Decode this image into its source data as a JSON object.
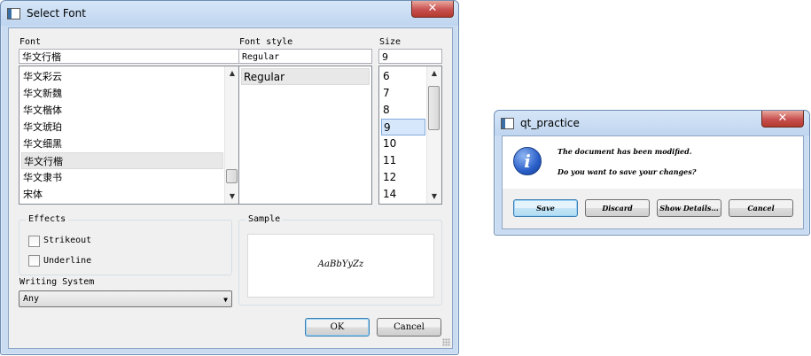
{
  "font_dialog": {
    "title": "Select Font",
    "close_symbol": "✕",
    "font": {
      "label": "Font",
      "value": "华文行楷",
      "items": [
        "华文彩云",
        "华文新魏",
        "华文楷体",
        "华文琥珀",
        "华文细黑",
        "华文行楷",
        "华文隶书",
        "宋体"
      ],
      "selected": "华文行楷"
    },
    "font_style": {
      "label": "Font style",
      "value": "Regular",
      "items": [
        "Regular"
      ],
      "selected": "Regular"
    },
    "size": {
      "label": "Size",
      "value": "9",
      "items": [
        "6",
        "7",
        "8",
        "9",
        "10",
        "11",
        "12",
        "14"
      ],
      "selected": "9"
    },
    "effects": {
      "title": "Effects",
      "strikeout": {
        "label": "Strikeout",
        "checked": false
      },
      "underline": {
        "label": "Underline",
        "checked": false
      }
    },
    "writing_system": {
      "label": "Writing System",
      "value": "Any"
    },
    "sample": {
      "title": "Sample",
      "text": "AaBbYyZz"
    },
    "buttons": {
      "ok": "OK",
      "cancel": "Cancel"
    }
  },
  "message_box": {
    "title": "qt_practice",
    "close_symbol": "✕",
    "icon": "information-icon",
    "text": "The document has been modified.",
    "informative_text": "Do you want to save your changes?",
    "buttons": {
      "save": "Save",
      "discard": "Discard",
      "show_details": "Show Details...",
      "cancel": "Cancel"
    }
  },
  "colors": {
    "accent": "#3c7fb1",
    "selection": "#d7e7fb",
    "close_button": "#c75050"
  }
}
